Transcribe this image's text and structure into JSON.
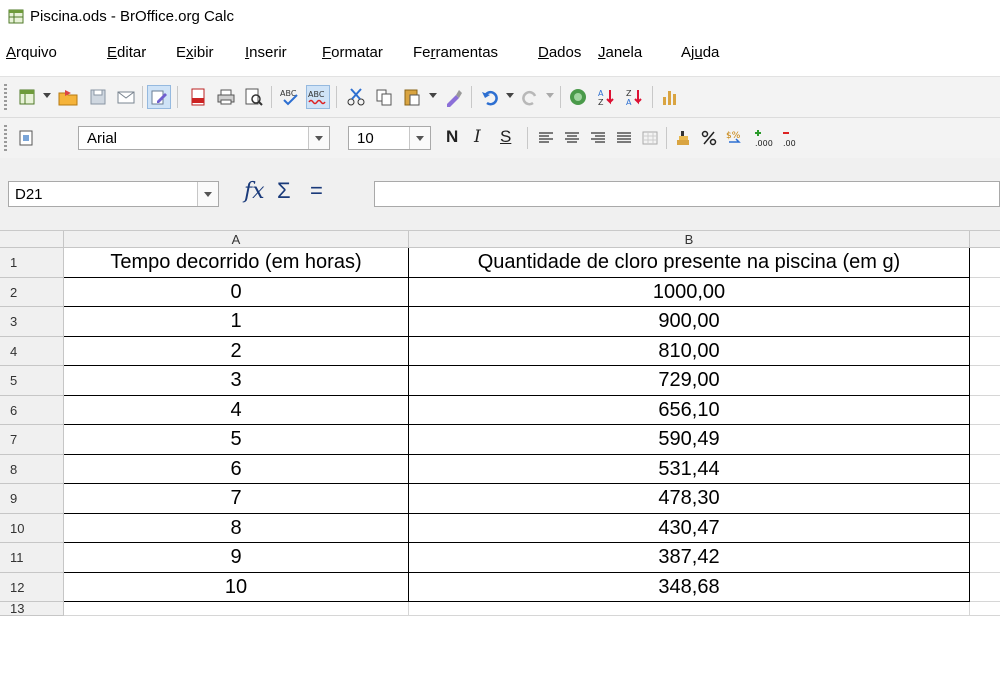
{
  "window": {
    "title": "Piscina.ods - BrOffice.org Calc"
  },
  "menu": {
    "items": [
      {
        "pre": "",
        "u": "A",
        "post": "rquivo"
      },
      {
        "pre": "",
        "u": "E",
        "post": "ditar"
      },
      {
        "pre": "E",
        "u": "x",
        "post": "ibir"
      },
      {
        "pre": "",
        "u": "I",
        "post": "nserir"
      },
      {
        "pre": "",
        "u": "F",
        "post": "ormatar"
      },
      {
        "pre": "Fe",
        "u": "r",
        "post": "ramentas"
      },
      {
        "pre": "",
        "u": "D",
        "post": "ados"
      },
      {
        "pre": "",
        "u": "J",
        "post": "anela"
      },
      {
        "pre": "Aj",
        "u": "u",
        "post": "da"
      }
    ]
  },
  "formatting": {
    "font_name": "Arial",
    "font_size": "10",
    "bold_label": "N",
    "italic_label": "I",
    "underline_label": "S"
  },
  "formula_bar": {
    "cell_reference": "D21",
    "content": ""
  },
  "sheet": {
    "columns": [
      "A",
      "B"
    ],
    "row_numbers": [
      "1",
      "2",
      "3",
      "4",
      "5",
      "6",
      "7",
      "8",
      "9",
      "10",
      "11",
      "12",
      "13"
    ],
    "header_row": [
      "Tempo decorrido (em horas)",
      "Quantidade de cloro presente na piscina (em g)"
    ],
    "rows": [
      [
        "0",
        "1000,00"
      ],
      [
        "1",
        "900,00"
      ],
      [
        "2",
        "810,00"
      ],
      [
        "3",
        "729,00"
      ],
      [
        "4",
        "656,10"
      ],
      [
        "5",
        "590,49"
      ],
      [
        "6",
        "531,44"
      ],
      [
        "7",
        "478,30"
      ],
      [
        "8",
        "430,47"
      ],
      [
        "9",
        "387,42"
      ],
      [
        "10",
        "348,68"
      ]
    ]
  }
}
